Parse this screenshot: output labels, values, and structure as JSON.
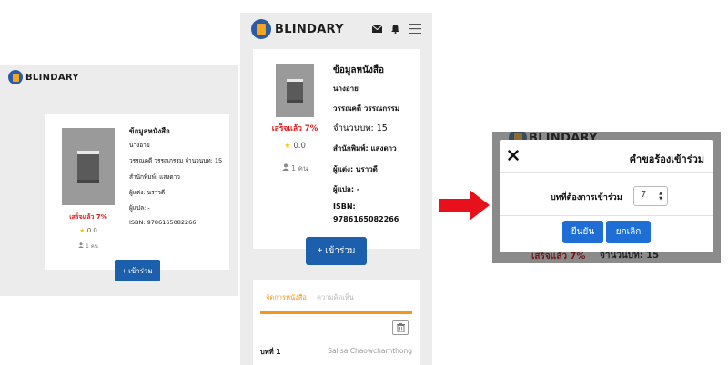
{
  "brand": {
    "name": "BLINDARY"
  },
  "book": {
    "section_title": "ข้อมูลหนังสือ",
    "author": "นางอาย",
    "genre": "วรรณคดี วรรณกรรม",
    "pages_label": "จำนวนบท: 15",
    "publisher": "สำนักพิมพ์: แสงดาว",
    "writer": "ผู้แต่ง: นราวดี",
    "translator": "ผู้แปล: -",
    "isbn_label": "ISBN:",
    "isbn_value": "9786165082266",
    "isbn_full": "ISBN: 9786165082266",
    "genre_pages": "วรรณคดี วรรณกรรม จำนวนบท: 15",
    "progress": "เสร็จแล้ว 7%",
    "rating": "0.0",
    "members": "1 คน"
  },
  "join_button": "+ เข้าร่วม",
  "tabs": [
    {
      "label": "จัดการหนังสือ",
      "active": true
    },
    {
      "label": "ความคิดเห็น",
      "active": false
    }
  ],
  "chapter_row": {
    "label": "บทที่ 1",
    "author": "Salisa Chaowcharnthong"
  },
  "modal": {
    "title": "คำขอร้องเข้าร่วม",
    "field_label": "บทที่ต้องการเข้าร่วม",
    "field_value": "7",
    "confirm": "ยืนยัน",
    "cancel": "ยกเลิก"
  },
  "background_behind_modal": {
    "progress": "เสร็จแล้ว 7%",
    "pages": "จำนวนบท: 15"
  },
  "icons": [
    "logo-icon",
    "book-cover-icon",
    "star-icon",
    "user-icon",
    "mail-icon",
    "bell-icon",
    "menu-icon",
    "trash-icon",
    "close-icon",
    "arrow-right-icon"
  ],
  "colors": {
    "primary": "#1c5fad",
    "accent": "#f3961c",
    "progress_red": "#e01b1b",
    "arrow": "#e8101a",
    "panel_bg": "#ececec"
  }
}
